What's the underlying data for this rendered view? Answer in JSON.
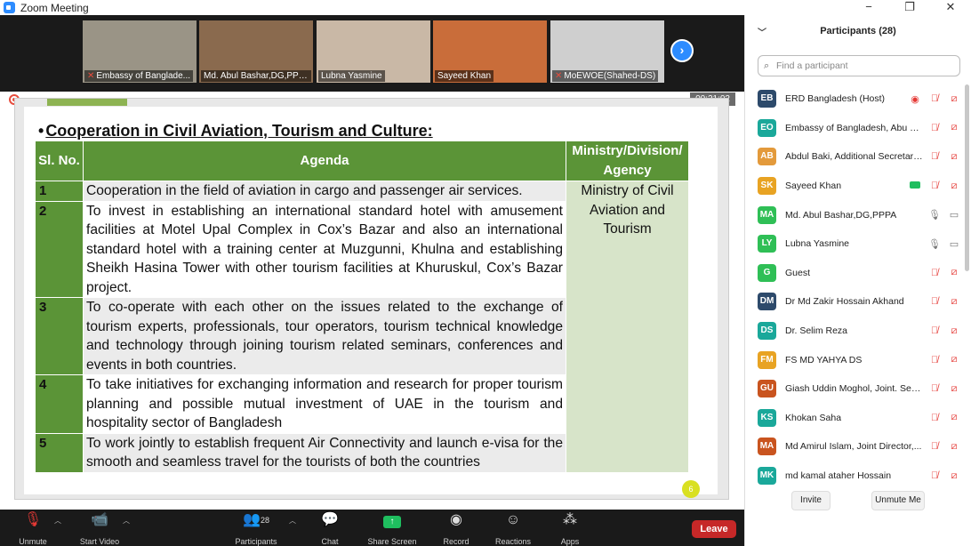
{
  "window": {
    "title": "Zoom Meeting",
    "controls": [
      "−",
      "❐",
      "✕"
    ]
  },
  "video_strip": {
    "tiles": [
      {
        "name": "Embassy of Banglade...",
        "muted": true,
        "bg": "#9a9486"
      },
      {
        "name": "Md. Abul Bashar,DG,PPPA",
        "muted": false,
        "bg": "#8a6a4e"
      },
      {
        "name": "Lubna Yasmine",
        "muted": false,
        "bg": "#c9b8a6"
      },
      {
        "name": "Sayeed Khan",
        "muted": false,
        "bg": "#c96d3a"
      },
      {
        "name": "MoEWOE(Shahed-DS)",
        "muted": true,
        "bg": "#cfcfcf"
      }
    ],
    "next_icon": "chevron-right-icon"
  },
  "share": {
    "timer": "00:21:02",
    "page_number": "6",
    "slide_title": "Cooperation in Civil Aviation, Tourism and Culture:",
    "bullet": "•",
    "headers": {
      "slno": "Sl. No.",
      "agenda": "Agenda",
      "ministry": "Ministry/Division/ Agency"
    },
    "rows": [
      {
        "no": "1",
        "text": "Cooperation in the field of aviation in cargo and passenger air services."
      },
      {
        "no": "2",
        "text": "To invest in establishing an international standard hotel with amusement facilities at Motel Upal Complex in Cox’s Bazar and also an international standard hotel with a training center at Muzgunni, Khulna and establishing Sheikh Hasina Tower with other tourism facilities at Khuruskul, Cox’s Bazar project."
      },
      {
        "no": "3",
        "text": "To co-operate with each other on the issues related to the exchange of tourism experts, professionals, tour operators, tourism technical knowledge and technology through joining tourism related seminars, conferences and events in both countries."
      },
      {
        "no": "4",
        "text": "To take initiatives for exchanging information and research for proper tourism planning and possible mutual investment of UAE in the tourism and hospitality sector of Bangladesh"
      },
      {
        "no": "5",
        "text": "To work jointly to establish frequent Air Connectivity and launch e-visa for the smooth and seamless travel for the tourists of both the countries"
      }
    ],
    "ministry": "Ministry of Civil Aviation and Tourism"
  },
  "toolbar": {
    "unmute": "Unmute",
    "start_video": "Start Video",
    "participants": "Participants",
    "participants_count": "28",
    "chat": "Chat",
    "share_screen": "Share Screen",
    "record": "Record",
    "reactions": "Reactions",
    "apps": "Apps",
    "leave": "Leave"
  },
  "panel": {
    "title": "Participants (28)",
    "search_placeholder": "Find a participant",
    "participants": [
      {
        "initials": "EB",
        "name": "ERD Bangladesh (Host)",
        "color": "#2d4a6b",
        "extra": "record"
      },
      {
        "initials": "EO",
        "name": "Embassy of Bangladesh, Abu D...",
        "color": "#1aa89a",
        "mic": "muted",
        "video": "off"
      },
      {
        "initials": "AB",
        "name": "Abdul Baki, Additional Secretary...",
        "color": "#e39a3b",
        "mic": "muted",
        "video": "off"
      },
      {
        "initials": "SK",
        "name": "Sayeed Khan",
        "color": "#e8a323",
        "extra": "share",
        "mic": "muted",
        "video": "off"
      },
      {
        "initials": "MA",
        "name": "Md. Abul Bashar,DG,PPPA",
        "color": "#2fbf56",
        "mic": "on",
        "video": "on"
      },
      {
        "initials": "LY",
        "name": "Lubna Yasmine",
        "color": "#2fbf56",
        "mic": "on",
        "video": "on"
      },
      {
        "initials": "G",
        "name": "Guest",
        "color": "#2fbf56",
        "mic": "muted",
        "video": "off"
      },
      {
        "initials": "DM",
        "name": "Dr Md Zakir Hossain Akhand",
        "color": "#2d4a6b",
        "mic": "muted",
        "video": "off"
      },
      {
        "initials": "DS",
        "name": "Dr. Selim Reza",
        "color": "#1aa89a",
        "mic": "muted",
        "video": "off"
      },
      {
        "initials": "FM",
        "name": "FS MD YAHYA DS",
        "color": "#e8a323",
        "mic": "muted",
        "video": "off"
      },
      {
        "initials": "GU",
        "name": "Giash Uddin Moghol, Joint. Sec....",
        "color": "#c9541f",
        "mic": "muted",
        "video": "off"
      },
      {
        "initials": "KS",
        "name": "Khokan Saha",
        "color": "#1aa89a",
        "mic": "muted",
        "video": "off"
      },
      {
        "initials": "MA",
        "name": "Md Amirul Islam, Joint Director,...",
        "color": "#c9541f",
        "mic": "muted",
        "video": "off"
      },
      {
        "initials": "MK",
        "name": "md kamal ataher Hossain",
        "color": "#1aa89a",
        "mic": "muted",
        "video": "off"
      }
    ],
    "invite": "Invite",
    "unmute_me": "Unmute Me"
  }
}
